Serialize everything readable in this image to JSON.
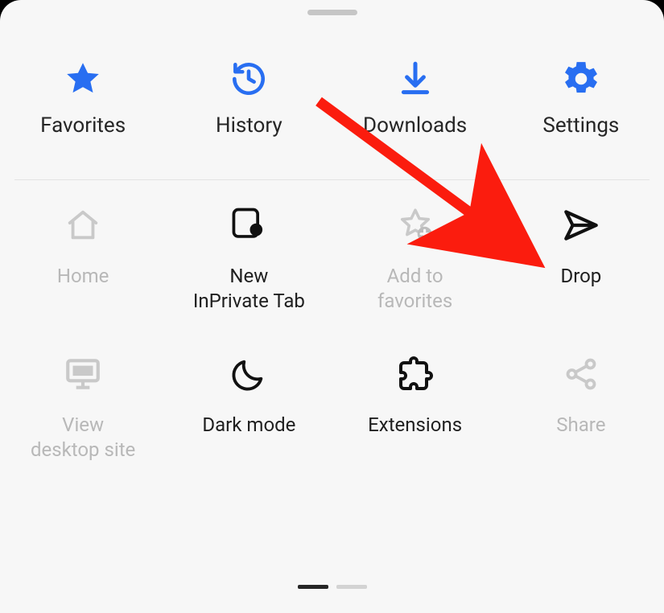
{
  "colors": {
    "accent": "#286ef1",
    "text": "#262626",
    "muted": "#b8b8b8"
  },
  "topRow": {
    "favorites": {
      "label": "Favorites"
    },
    "history": {
      "label": "History"
    },
    "downloads": {
      "label": "Downloads"
    },
    "settings": {
      "label": "Settings"
    }
  },
  "grid": {
    "home": {
      "label": "Home",
      "enabled": false
    },
    "newInPrivate": {
      "label": "New\nInPrivate Tab",
      "enabled": true
    },
    "addFav": {
      "label": "Add to\nfavorites",
      "enabled": false
    },
    "drop": {
      "label": "Drop",
      "enabled": true
    },
    "viewDesktop": {
      "label": "View\ndesktop site",
      "enabled": false
    },
    "darkMode": {
      "label": "Dark mode",
      "enabled": true
    },
    "extensions": {
      "label": "Extensions",
      "enabled": true
    },
    "share": {
      "label": "Share",
      "enabled": false
    }
  },
  "pager": {
    "pages": 2,
    "active": 0
  },
  "annotation": {
    "target": "drop",
    "style": "red-arrow"
  }
}
